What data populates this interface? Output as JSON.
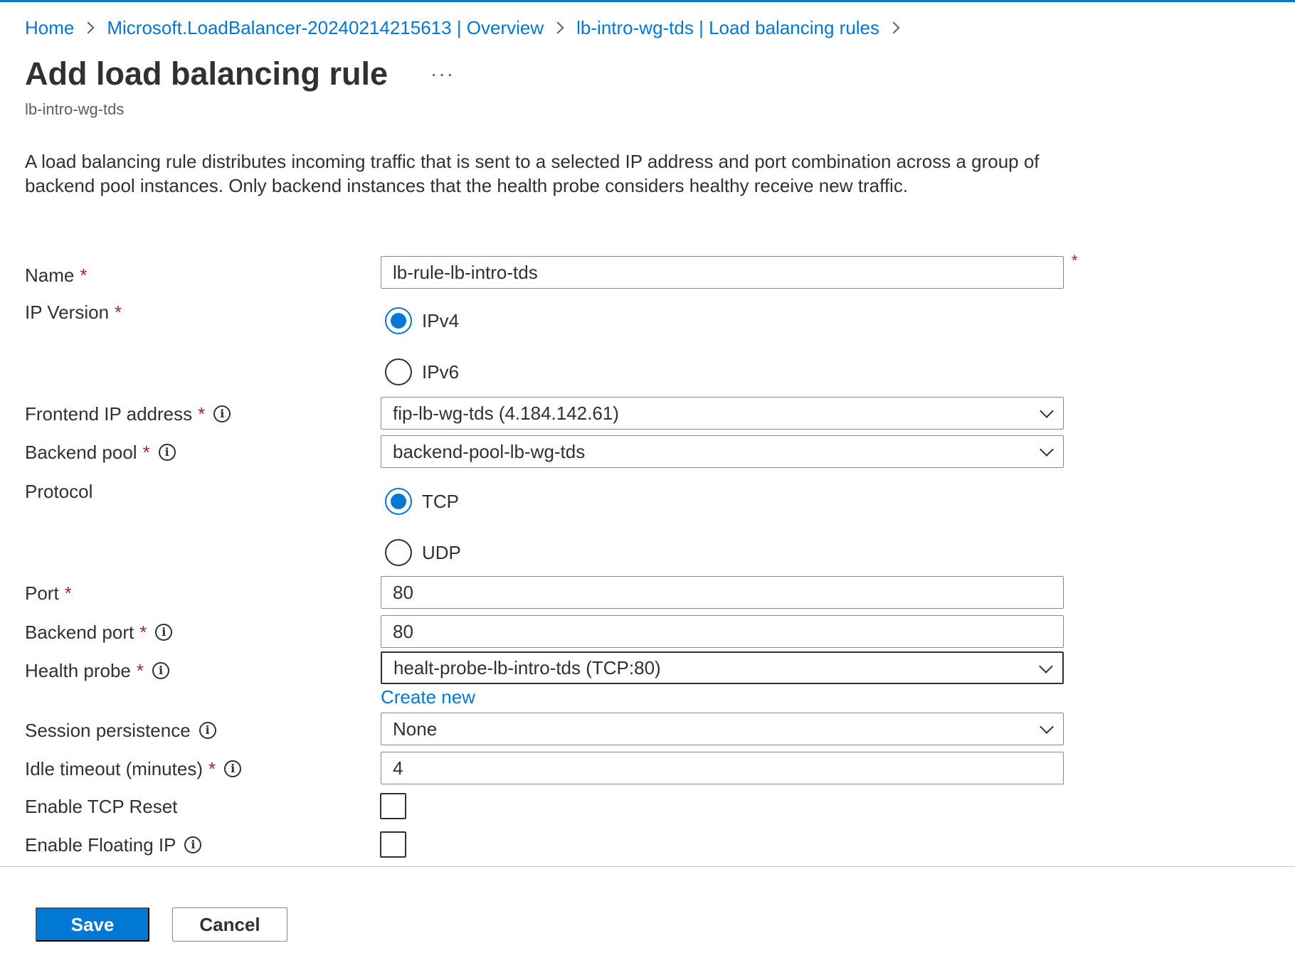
{
  "breadcrumb": [
    {
      "label": "Home"
    },
    {
      "label": "Microsoft.LoadBalancer-20240214215613 | Overview"
    },
    {
      "label": "lb-intro-wg-tds | Load balancing rules"
    }
  ],
  "header": {
    "title": "Add load balancing rule",
    "more": "···",
    "subtitle": "lb-intro-wg-tds"
  },
  "description": "A load balancing rule distributes incoming traffic that is sent to a selected IP address and port combination across a group of backend pool instances. Only backend instances that the health probe considers healthy receive new traffic.",
  "required_marker": "*",
  "form": {
    "name": {
      "label": "Name",
      "value": "lb-rule-lb-intro-tds"
    },
    "ip_version": {
      "label": "IP Version",
      "options": [
        "IPv4",
        "IPv6"
      ],
      "selected": "IPv4"
    },
    "frontend_ip": {
      "label": "Frontend IP address",
      "value": "fip-lb-wg-tds (4.184.142.61)"
    },
    "backend_pool": {
      "label": "Backend pool",
      "value": "backend-pool-lb-wg-tds"
    },
    "protocol": {
      "label": "Protocol",
      "options": [
        "TCP",
        "UDP"
      ],
      "selected": "TCP"
    },
    "port": {
      "label": "Port",
      "value": "80"
    },
    "backend_port": {
      "label": "Backend port",
      "value": "80"
    },
    "health_probe": {
      "label": "Health probe",
      "value": "healt-probe-lb-intro-tds (TCP:80)",
      "create_new": "Create new"
    },
    "session_persistence": {
      "label": "Session persistence",
      "value": "None"
    },
    "idle_timeout": {
      "label": "Idle timeout (minutes)",
      "value": "4"
    },
    "tcp_reset": {
      "label": "Enable TCP Reset",
      "checked": false
    },
    "floating_ip": {
      "label": "Enable Floating IP",
      "checked": false
    }
  },
  "info_glyph": "i",
  "footer": {
    "save_label": "Save",
    "cancel_label": "Cancel"
  },
  "colors": {
    "accent": "#0078d4",
    "required": "#a4262c",
    "text": "#323130",
    "border": "#8a8886"
  }
}
